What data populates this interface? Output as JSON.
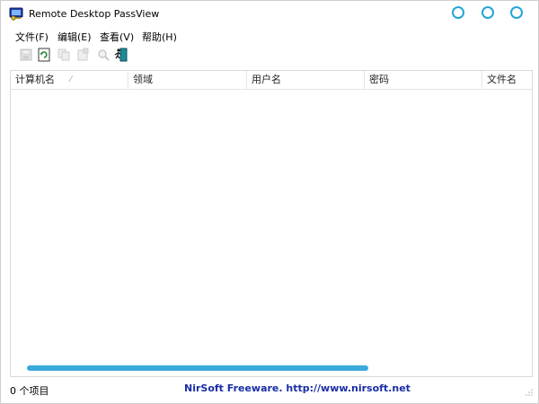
{
  "window": {
    "title": "Remote Desktop PassView"
  },
  "menu": {
    "items": [
      {
        "label": "文件(F)"
      },
      {
        "label": "编辑(E)"
      },
      {
        "label": "查看(V)"
      },
      {
        "label": "帮助(H)"
      }
    ]
  },
  "toolbar": {
    "buttons": [
      {
        "icon": "save-icon",
        "enabled": false
      },
      {
        "icon": "refresh-icon",
        "enabled": true
      },
      {
        "icon": "copy-icon",
        "enabled": false
      },
      {
        "icon": "html-report-icon",
        "enabled": false
      },
      {
        "icon": "find-icon",
        "enabled": false
      },
      {
        "icon": "exit-icon",
        "enabled": true
      }
    ]
  },
  "list": {
    "columns": [
      {
        "label": "计算机名",
        "sorted": true
      },
      {
        "label": "领域"
      },
      {
        "label": "用户名"
      },
      {
        "label": "密码"
      },
      {
        "label": "文件名"
      }
    ],
    "rows": []
  },
  "status": {
    "count": "0 个项目",
    "link": "NirSoft Freeware.  http://www.nirsoft.net"
  },
  "colors": {
    "accent": "#22a6d8",
    "scrollbar": "#3aa9dc",
    "link": "#1a2ea6"
  }
}
